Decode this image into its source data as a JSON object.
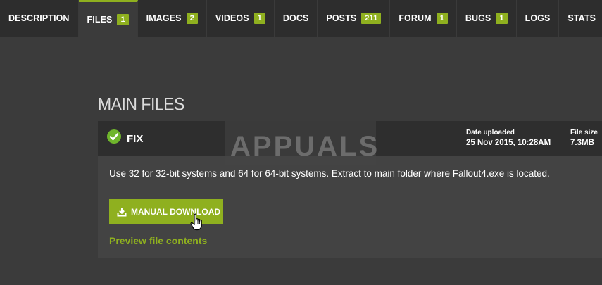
{
  "tabs": [
    {
      "label": "DESCRIPTION",
      "badge": null,
      "active": false
    },
    {
      "label": "FILES",
      "badge": "1",
      "active": true
    },
    {
      "label": "IMAGES",
      "badge": "2",
      "active": false
    },
    {
      "label": "VIDEOS",
      "badge": "1",
      "active": false
    },
    {
      "label": "DOCS",
      "badge": null,
      "active": false
    },
    {
      "label": "POSTS",
      "badge": "211",
      "active": false
    },
    {
      "label": "FORUM",
      "badge": "1",
      "active": false
    },
    {
      "label": "BUGS",
      "badge": "1",
      "active": false
    },
    {
      "label": "LOGS",
      "badge": null,
      "active": false
    },
    {
      "label": "STATS",
      "badge": null,
      "active": false
    }
  ],
  "section": {
    "title": "MAIN FILES"
  },
  "file": {
    "name": "FIX",
    "status_icon": "check-circle-icon",
    "date_label": "Date uploaded",
    "date_value": "25 Nov 2015, 10:28AM",
    "size_label": "File size",
    "size_value": "7.3MB",
    "description": "Use 32 for 32-bit systems and 64 for 64-bit systems. Extract to main folder where Fallout4.exe is located.",
    "download_label": "MANUAL DOWNLOAD",
    "preview_label": "Preview file contents"
  },
  "watermark": {
    "text": "APPUALS"
  },
  "colors": {
    "accent": "#8fb01f",
    "tabbar": "#2a2a2a",
    "page": "#3b3b3b",
    "card": "#434343",
    "card_header": "#2e2e2e"
  }
}
